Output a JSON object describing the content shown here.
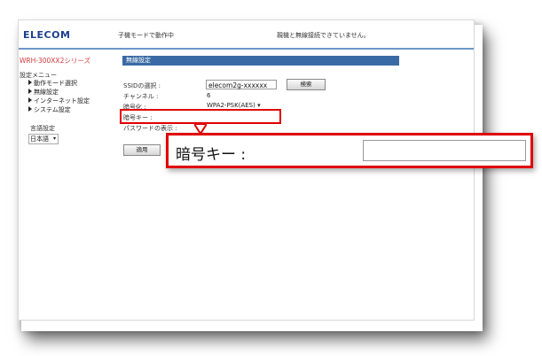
{
  "header": {
    "logo": "ELECOM",
    "mode_text": "子機モードで動作中",
    "status_text": "親機と無線接続できていません。"
  },
  "sidebar": {
    "series": "WRH-300XX2シリーズ",
    "menu_title": "設定メニュー",
    "items": [
      {
        "label": "動作モード選択"
      },
      {
        "label": "無線設定"
      },
      {
        "label": "インターネット設定"
      },
      {
        "label": "システム設定"
      }
    ],
    "language_label": "言語設定",
    "language_value": "日本語"
  },
  "main": {
    "section_title": "無線設定",
    "ssid_label": "SSIDの選択 :",
    "ssid_value": "elecom2g-xxxxxx",
    "search_button": "検索",
    "channel_label": "チャンネル :",
    "channel_value": "6",
    "encryption_label": "暗号化 :",
    "encryption_value": "WPA2-PSK(AES)",
    "key_label": "暗号キー :",
    "password_label": "パスワードの表示 :",
    "apply_button": "適用"
  },
  "callout": {
    "label": "暗号キー :",
    "color": "#e00000"
  }
}
